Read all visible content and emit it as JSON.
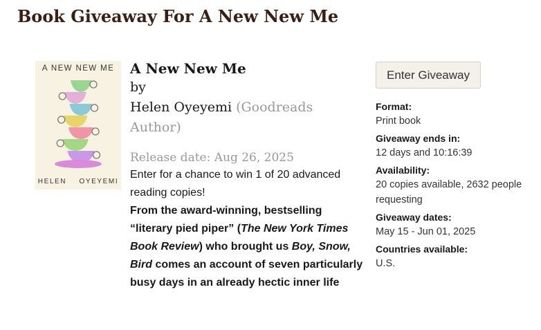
{
  "page": {
    "title": "Book Giveaway For A New New Me"
  },
  "cover": {
    "title_text": "A NEW NEW ME",
    "author_text": "HELEN OYEYEMI",
    "cup_colors": [
      "#8fd18a",
      "#e0a8d8",
      "#7ec6d6",
      "#e6d15a",
      "#f08aa0",
      "#9ad47a",
      "#c48ee8"
    ]
  },
  "book": {
    "title": "A New New Me",
    "by": "by",
    "author": "Helen Oyeyemi",
    "author_role": "(Goodreads Author)",
    "release_date": "Release date: Aug 26, 2025",
    "intro": "Enter for a chance to win 1 of 20 advanced reading copies!",
    "desc_part1": "From the award-winning, bestselling “literary pied piper” (",
    "desc_italic1": "The New York Times Book Review",
    "desc_part2": ") who brought us ",
    "desc_italic2": "Boy, Snow, Bird",
    "desc_part3": " comes an account of seven particularly busy days in an already hectic inner life"
  },
  "sidebar": {
    "enter_button": "Enter Giveaway",
    "format_label": "Format:",
    "format_value": "Print book",
    "ends_label": "Giveaway ends in:",
    "ends_value": "12 days and 10:16:39",
    "availability_label": "Availability:",
    "availability_value": "20 copies available, 2632 people requesting",
    "dates_label": "Giveaway dates:",
    "dates_value": "May 15 - Jun 01, 2025",
    "countries_label": "Countries available:",
    "countries_value": "U.S."
  },
  "colors": {
    "title_brown": "#382110",
    "muted_gray": "#999999",
    "button_bg": "#f4f1ea"
  }
}
